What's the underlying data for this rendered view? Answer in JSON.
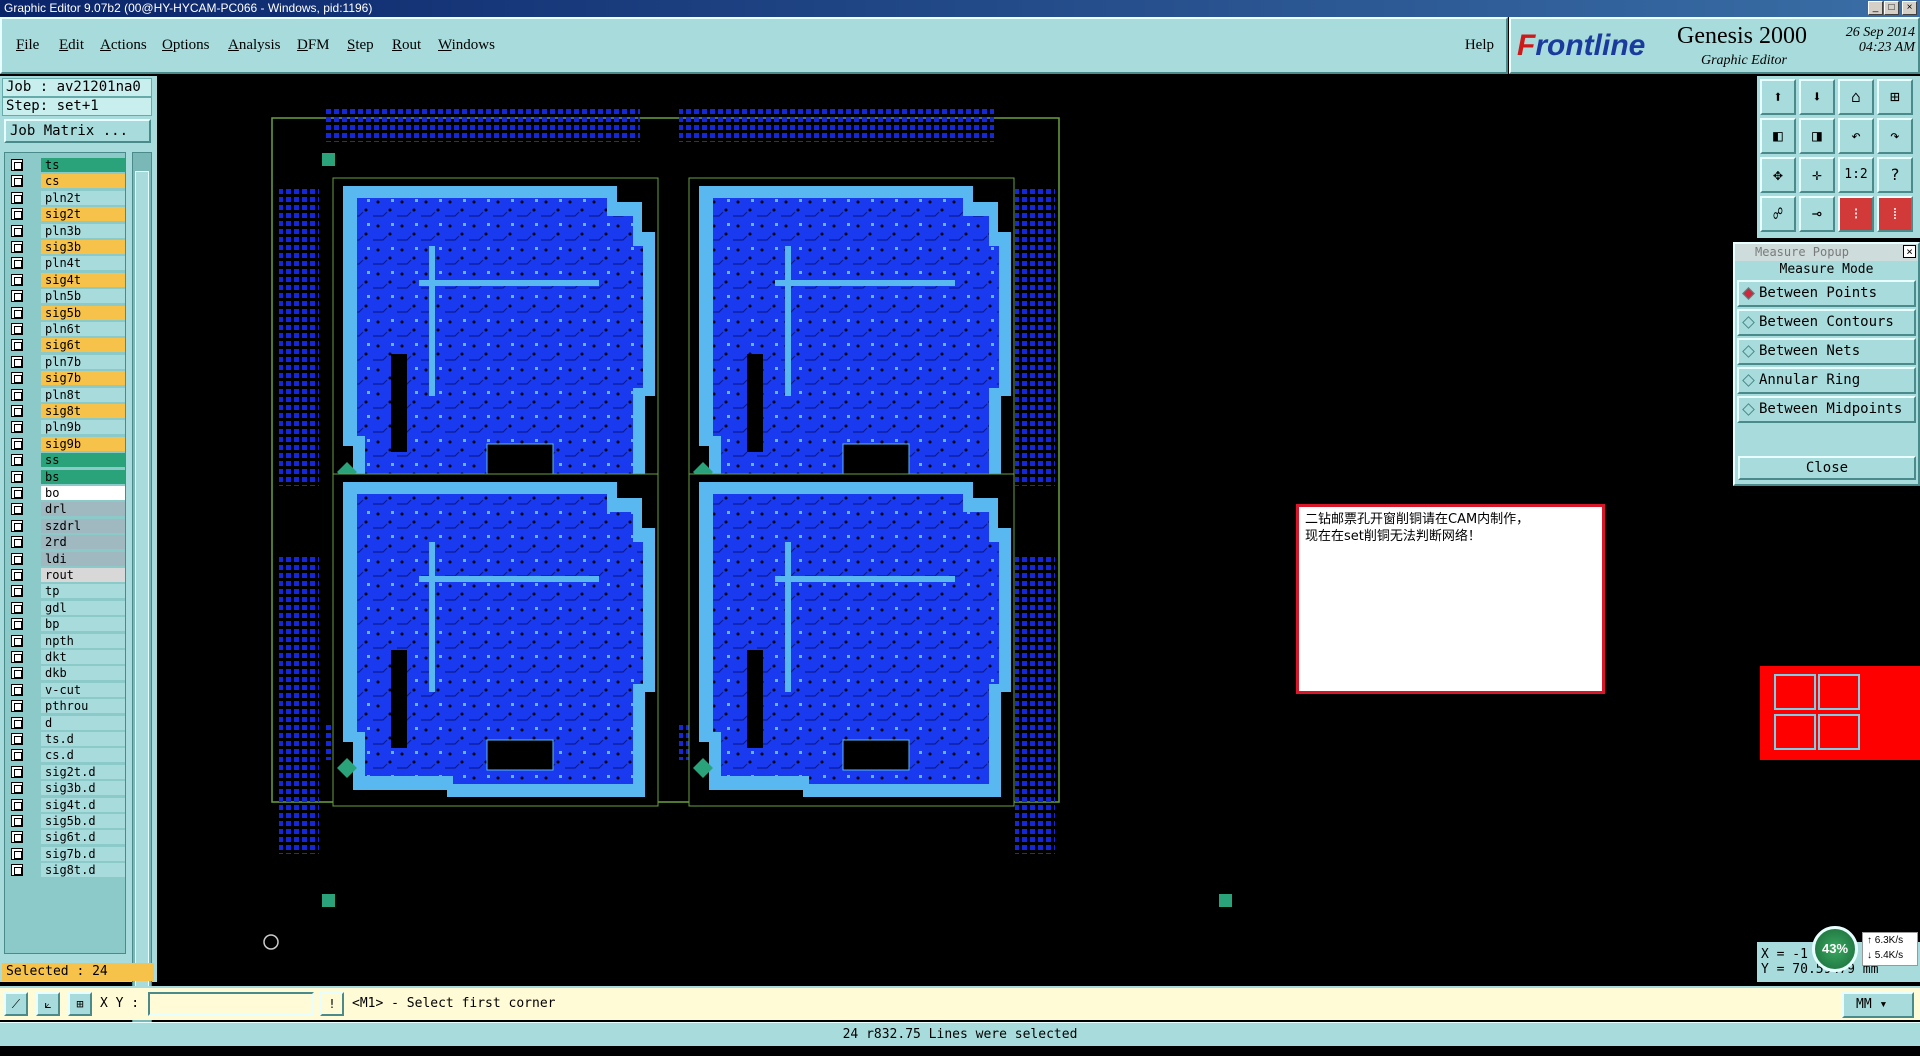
{
  "window": {
    "title": "Graphic Editor 9.07b2 (00@HY-HYCAM-PC066 - Windows, pid:1196)",
    "controls": [
      "_",
      "□",
      "×"
    ]
  },
  "menu": {
    "items": [
      "File",
      "Edit",
      "Actions",
      "Options",
      "Analysis",
      "DFM",
      "Step",
      "Rout",
      "Windows"
    ],
    "help": "Help"
  },
  "logo": {
    "brand_f": "F",
    "brand_rest": "rontline",
    "product": "Genesis 2000",
    "sub": "Graphic Editor",
    "date": "26 Sep 2014",
    "time": "04:23 AM"
  },
  "left": {
    "job": "Job : av21201na0",
    "step": "Step: set+1",
    "job_matrix": "Job Matrix ...",
    "selected": "Selected : 24",
    "colors": {
      "signal": "#f7c24a",
      "plane": "#a8dcdc",
      "solder": "#2aa37a",
      "drill": "#a0b8c0",
      "white": "#ffffff"
    },
    "layers": [
      {
        "name": "ts",
        "color": "#2aa37a"
      },
      {
        "name": "cs",
        "color": "#f7c24a"
      },
      {
        "name": "pln2t",
        "color": "#a8dcdc"
      },
      {
        "name": "sig2t",
        "color": "#f7c24a"
      },
      {
        "name": "pln3b",
        "color": "#a8dcdc"
      },
      {
        "name": "sig3b",
        "color": "#f7c24a"
      },
      {
        "name": "pln4t",
        "color": "#a8dcdc"
      },
      {
        "name": "sig4t",
        "color": "#f7c24a"
      },
      {
        "name": "pln5b",
        "color": "#a8dcdc"
      },
      {
        "name": "sig5b",
        "color": "#f7c24a"
      },
      {
        "name": "pln6t",
        "color": "#a8dcdc"
      },
      {
        "name": "sig6t",
        "color": "#f7c24a"
      },
      {
        "name": "pln7b",
        "color": "#a8dcdc"
      },
      {
        "name": "sig7b",
        "color": "#f7c24a"
      },
      {
        "name": "pln8t",
        "color": "#a8dcdc"
      },
      {
        "name": "sig8t",
        "color": "#f7c24a"
      },
      {
        "name": "pln9b",
        "color": "#a8dcdc"
      },
      {
        "name": "sig9b",
        "color": "#f7c24a"
      },
      {
        "name": "ss",
        "color": "#2aa37a"
      },
      {
        "name": "bs",
        "color": "#2aa37a"
      },
      {
        "name": "bo",
        "color": "#ffffff"
      },
      {
        "name": "drl",
        "color": "#a0b8c0"
      },
      {
        "name": "szdrl",
        "color": "#a0b8c0"
      },
      {
        "name": "2rd",
        "color": "#a0b8c0"
      },
      {
        "name": "ldi",
        "color": "#a0b8c0"
      },
      {
        "name": "rout",
        "color": "#d8d8d8"
      },
      {
        "name": "tp",
        "color": "#a8dcdc"
      },
      {
        "name": "gdl",
        "color": "#a8dcdc"
      },
      {
        "name": "bp",
        "color": "#a8dcdc"
      },
      {
        "name": "npth",
        "color": "#a8dcdc"
      },
      {
        "name": "dkt",
        "color": "#a8dcdc"
      },
      {
        "name": "dkb",
        "color": "#a8dcdc"
      },
      {
        "name": "v-cut",
        "color": "#a8dcdc"
      },
      {
        "name": "pthrou",
        "color": "#a8dcdc"
      },
      {
        "name": "d",
        "color": "#a8dcdc"
      },
      {
        "name": "ts.d",
        "color": "#a8dcdc"
      },
      {
        "name": "cs.d",
        "color": "#a8dcdc"
      },
      {
        "name": "sig2t.d",
        "color": "#a8dcdc"
      },
      {
        "name": "sig3b.d",
        "color": "#a8dcdc"
      },
      {
        "name": "sig4t.d",
        "color": "#a8dcdc"
      },
      {
        "name": "sig5b.d",
        "color": "#a8dcdc"
      },
      {
        "name": "sig6t.d",
        "color": "#a8dcdc"
      },
      {
        "name": "sig7b.d",
        "color": "#a8dcdc"
      },
      {
        "name": "sig8t.d",
        "color": "#a8dcdc"
      }
    ]
  },
  "note": {
    "line1": "二钻邮票孔开窗削铜请在CAM内制作，",
    "line2": "现在在set削铜无法判断网络！"
  },
  "tools": {
    "icons": [
      "open-icon",
      "save-icon",
      "home-icon",
      "layout-icon",
      "arrow-left-icon",
      "arrow-right-icon",
      "undo-icon",
      "redo-icon",
      "fit-icon",
      "center-icon",
      "ratio-icon",
      "help-icon",
      "snap-icon",
      "measure-icon",
      "pins-icon",
      "pins2-icon"
    ],
    "ratio_label": "1:2",
    "help_label": "?"
  },
  "measure": {
    "title": "Measure Popup",
    "header": "Measure Mode",
    "options": [
      "Between Points",
      "Between Contours",
      "Between Nets",
      "Annular Ring",
      "Between Midpoints"
    ],
    "selected_index": 0,
    "close": "Close"
  },
  "coords": {
    "x": "X = -1",
    "y": "Y = 70.59479 mm"
  },
  "net": {
    "percent": "43%",
    "up": "6.3K/s",
    "down": "5.4K/s"
  },
  "command": {
    "xy_label": "X Y :",
    "xy_value": "",
    "prompt": "<M1> - Select first corner",
    "unit": "MM"
  },
  "status": "24 r832.75 Lines were selected"
}
